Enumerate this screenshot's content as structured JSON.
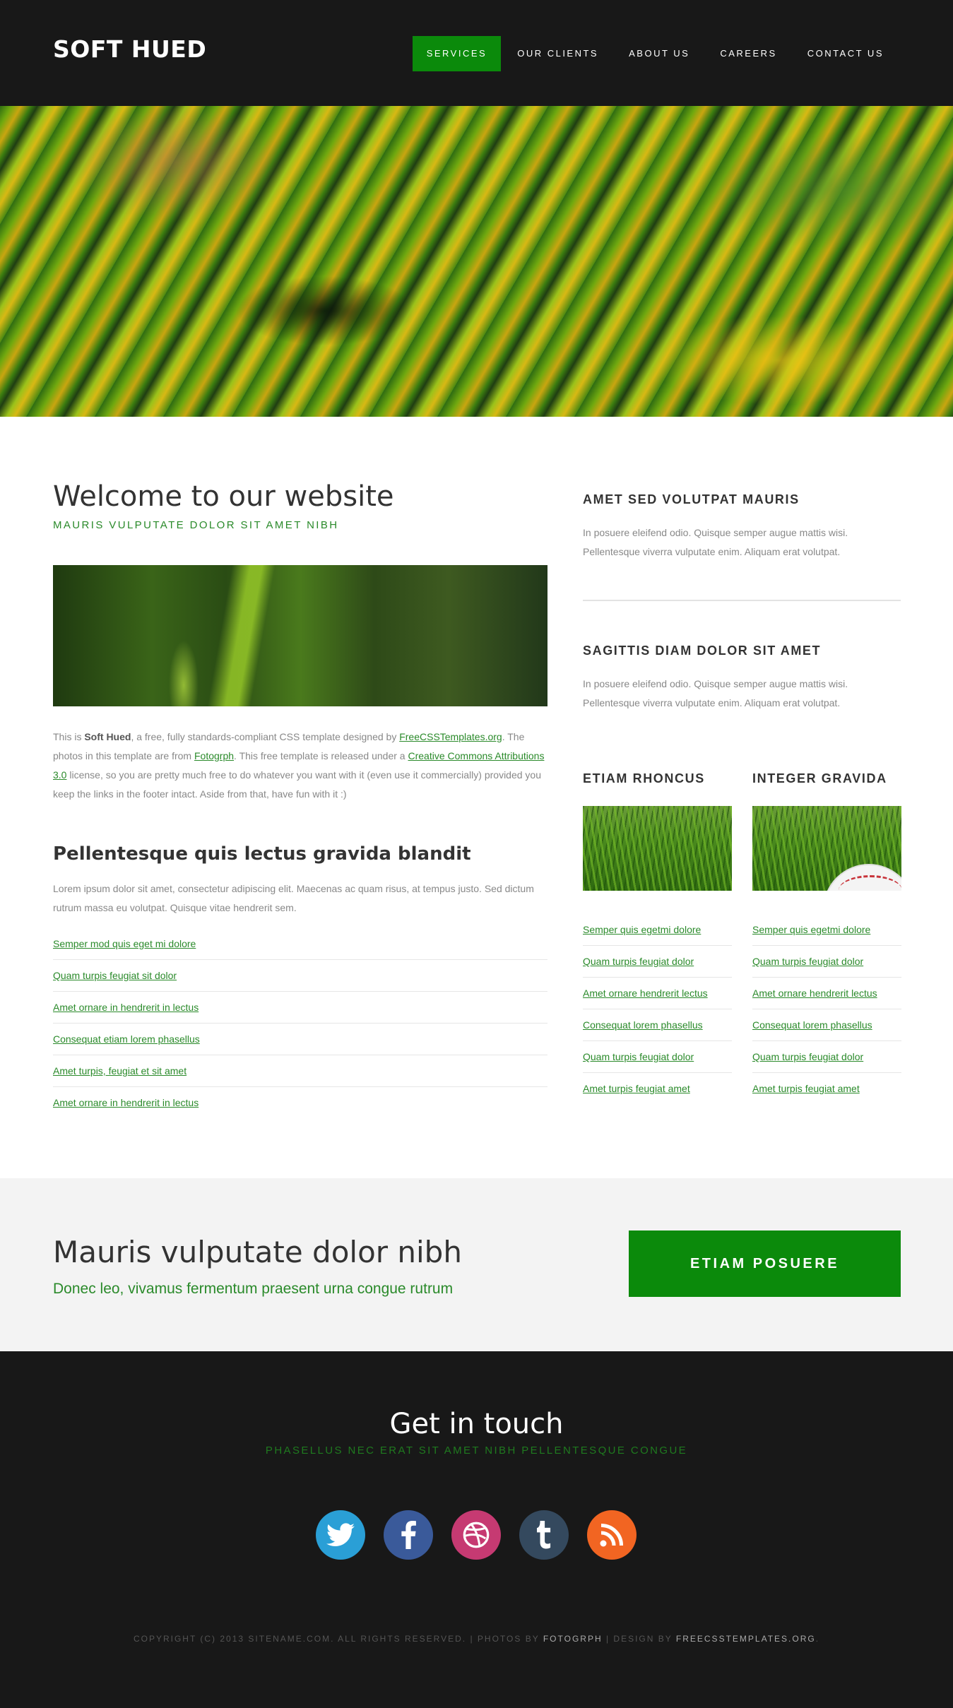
{
  "header": {
    "logo": "SOFT HUED",
    "nav": [
      {
        "label": "SERVICES",
        "active": true
      },
      {
        "label": "OUR CLIENTS",
        "active": false
      },
      {
        "label": "ABOUT US",
        "active": false
      },
      {
        "label": "CAREERS",
        "active": false
      },
      {
        "label": "CONTACT US",
        "active": false
      }
    ]
  },
  "main": {
    "title": "Welcome to our website",
    "subtitle": "MAURIS VULPUTATE DOLOR SIT AMET NIBH",
    "intro": {
      "t1": "This is ",
      "b1": "Soft Hued",
      "t2": ", a free, fully standards-compliant CSS template designed by ",
      "l1": "FreeCSSTemplates.org",
      "t3": ". The photos in this template are from ",
      "l2": "Fotogrph",
      "t4": ". This free template is released under a ",
      "l3": "Creative Commons Attributions 3.0",
      "t5": " license, so you are pretty much free to do whatever you want with it (even use it commercially) provided you keep the links in the footer intact. Aside from that, have fun with it :)"
    },
    "section2": {
      "title": "Pellentesque quis lectus gravida blandit",
      "text": "Lorem ipsum dolor sit amet, consectetur adipiscing elit. Maecenas ac quam risus, at tempus justo. Sed dictum rutrum massa eu volutpat. Quisque vitae hendrerit sem.",
      "links": [
        "Semper mod quis eget mi dolore",
        "Quam turpis feugiat sit dolor",
        "Amet ornare in hendrerit in lectus",
        "Consequat etiam lorem phasellus",
        "Amet turpis, feugiat et sit amet",
        "Amet ornare in hendrerit in lectus"
      ]
    }
  },
  "sidebar": {
    "box1": {
      "title": "AMET SED VOLUTPAT MAURIS",
      "text": "In posuere eleifend odio. Quisque semper augue mattis wisi. Pellentesque viverra vulputate enim. Aliquam erat volutpat."
    },
    "box2": {
      "title": "SAGITTIS DIAM DOLOR SIT AMET",
      "text": "In posuere eleifend odio. Quisque semper augue mattis wisi. Pellentesque viverra vulputate enim. Aliquam erat volutpat."
    },
    "col1": {
      "title": "ETIAM RHONCUS",
      "links": [
        "Semper quis egetmi dolore",
        "Quam turpis feugiat dolor",
        "Amet ornare hendrerit lectus",
        "Consequat lorem phasellus",
        "Quam turpis feugiat dolor",
        "Amet turpis feugiat amet"
      ]
    },
    "col2": {
      "title": "INTEGER GRAVIDA",
      "links": [
        "Semper quis egetmi dolore",
        "Quam turpis feugiat dolor",
        "Amet ornare hendrerit lectus",
        "Consequat lorem phasellus",
        "Quam turpis feugiat dolor",
        "Amet turpis feugiat amet"
      ]
    }
  },
  "cta": {
    "title": "Mauris vulputate dolor nibh",
    "subtitle": "Donec leo, vivamus fermentum praesent urna congue rutrum",
    "button": "ETIAM POSUERE"
  },
  "footer": {
    "title": "Get in touch",
    "subtitle": "PHASELLUS NEC ERAT SIT AMET NIBH PELLENTESQUE CONGUE",
    "socials": [
      {
        "name": "twitter",
        "icon": "twitter-icon",
        "color": "#2a9fd6"
      },
      {
        "name": "facebook",
        "icon": "facebook-icon",
        "color": "#3a5a9a"
      },
      {
        "name": "dribbble",
        "icon": "dribbble-icon",
        "color": "#c63a72"
      },
      {
        "name": "tumblr",
        "icon": "tumblr-icon",
        "color": "#34495e"
      },
      {
        "name": "rss",
        "icon": "rss-icon",
        "color": "#f26522"
      }
    ],
    "copyright": {
      "c1": "COPYRIGHT (C) 2013 SITENAME.COM. ALL RIGHTS RESERVED.  |  PHOTOS BY ",
      "l1": "FOTOGRPH",
      "c2": "  |  DESIGN BY ",
      "l2": "FREECSSTEMPLATES.ORG",
      "c3": "."
    }
  },
  "colors": {
    "accent": "#0b8a0b",
    "dark": "#181818",
    "link": "#2a8a2a"
  }
}
